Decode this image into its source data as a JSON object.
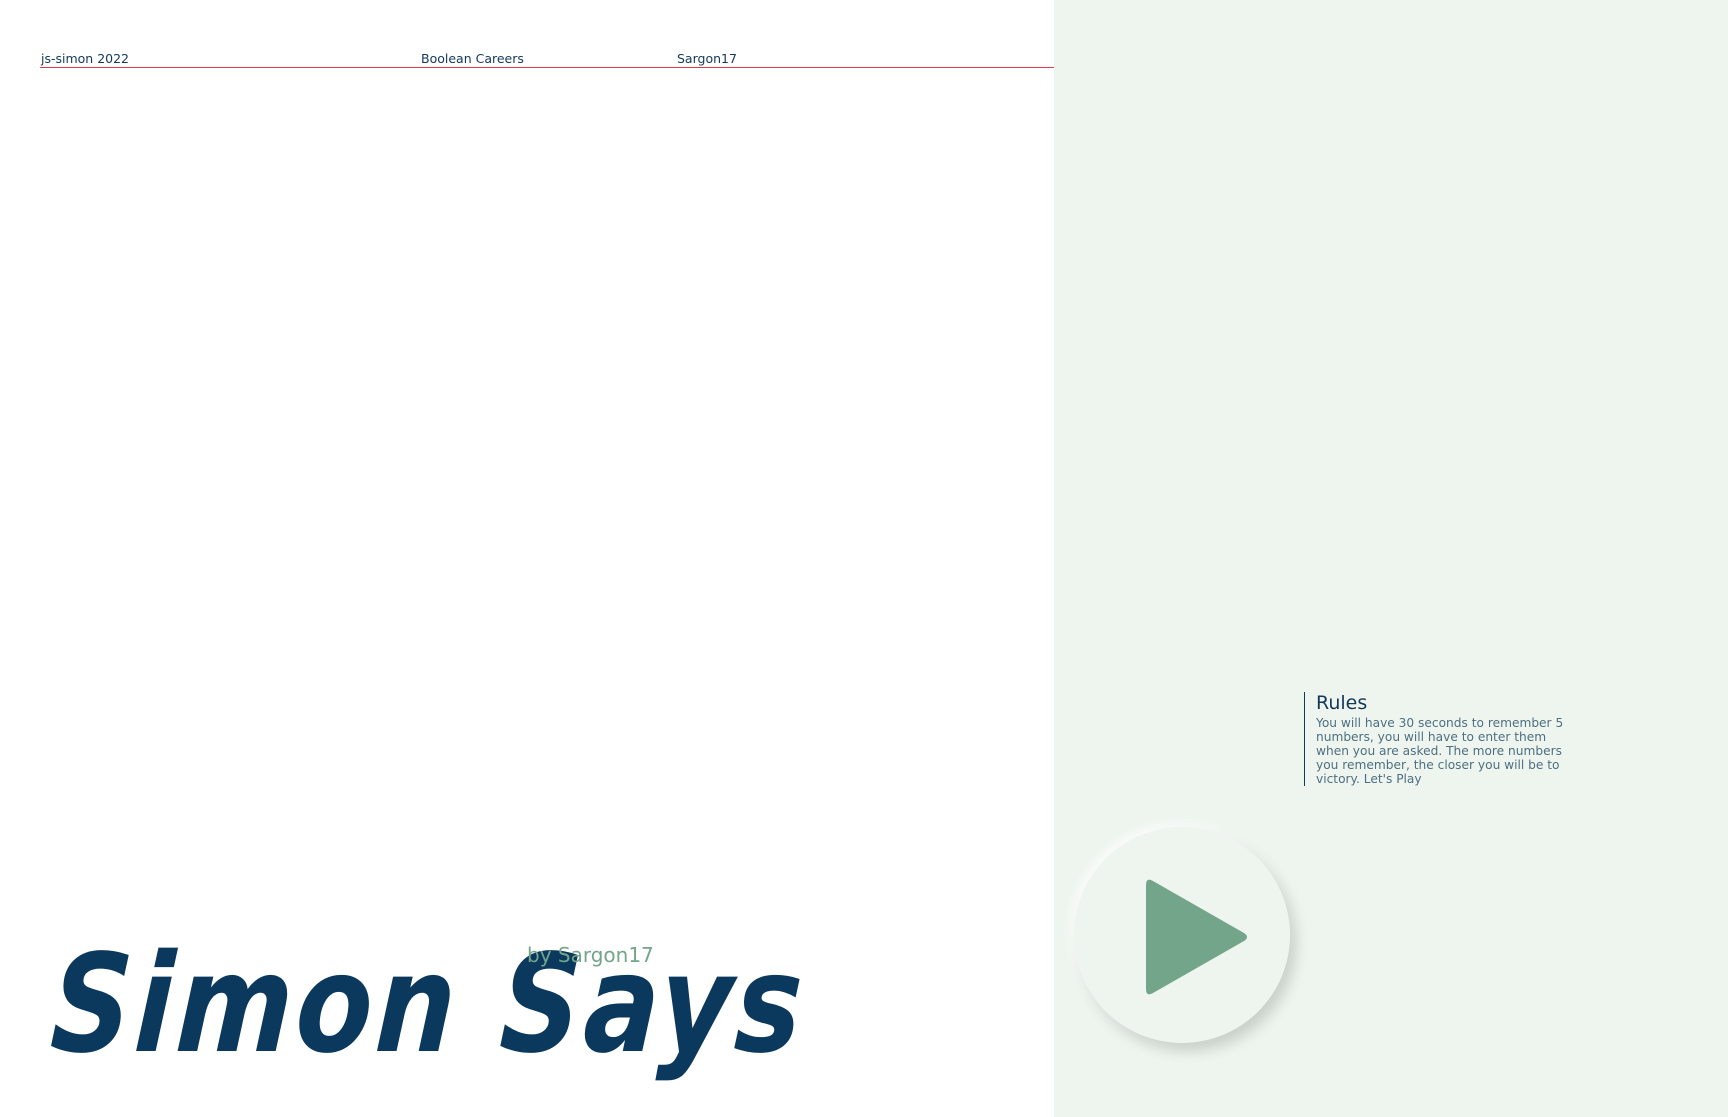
{
  "header": {
    "project": "js-simon 2022",
    "school": "Boolean Careers",
    "author": "Sargon17"
  },
  "hero": {
    "title": "Simon Says",
    "byline": "by Sargon17"
  },
  "rules": {
    "title": "Rules",
    "text": "You will have 30 seconds to remember 5 numbers, you will have to enter them when you are asked. The more numbers you remember, the closer you will be to victory. Let's Play"
  },
  "play_button": {
    "icon": "play-icon"
  },
  "colors": {
    "accent_line": "#e23a4a",
    "title": "#0b395e",
    "byline": "#73a58a",
    "panel_bg": "#eef5ee",
    "play_icon": "#73a58a",
    "text": "#12385a"
  }
}
